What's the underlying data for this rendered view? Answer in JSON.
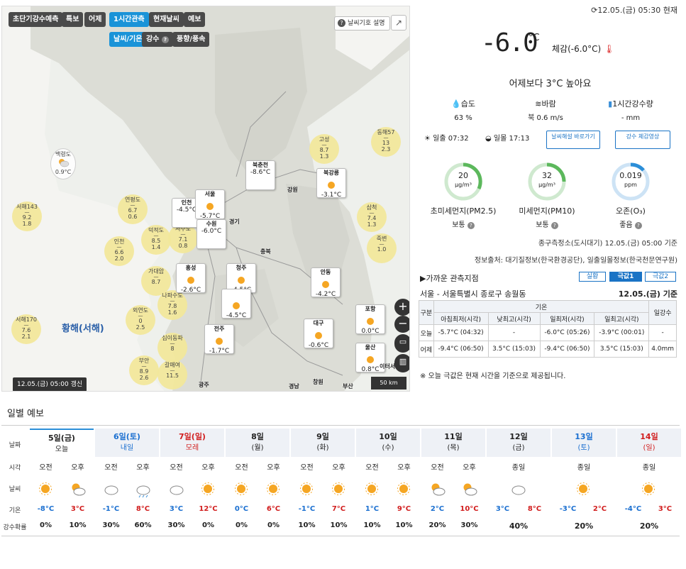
{
  "map": {
    "tabs": [
      "초단기강수예측",
      "특보",
      "어제",
      "1시간관측",
      "현재날씨",
      "예보"
    ],
    "subtabs": [
      "날씨/기온",
      "강수",
      "풍향/풍속"
    ],
    "legend_label": "날씨기호 설명",
    "update_label": "12.05.(금) 05:00 갱신",
    "sea_label": "황해(서해)",
    "scale_label": "50 km",
    "bubbles": [
      {
        "name": "백령도",
        "val": "0.9°C"
      },
      {
        "name": "서해143",
        "val": "9.2",
        "val2": "1.8"
      },
      {
        "name": "연평도",
        "val": "6.7",
        "val2": "0.6"
      },
      {
        "name": "덕적도",
        "val": "8.5",
        "val2": "1.4"
      },
      {
        "name": "서수도",
        "val": "7.1",
        "val2": "0.8"
      },
      {
        "name": "인천",
        "val": "6.6",
        "val2": "2.0"
      },
      {
        "name": "가대암",
        "val": "8.7"
      },
      {
        "name": "나파수도",
        "val": "7.8",
        "val2": "1.6"
      },
      {
        "name": "외연도",
        "val": "0",
        "val2": "2.5"
      },
      {
        "name": "서해170",
        "val": "7.6",
        "val2": "2.1"
      },
      {
        "name": "십이동파",
        "val": "8"
      },
      {
        "name": "부안",
        "val": "8.9",
        "val2": "2.6"
      },
      {
        "name": "갈매여",
        "val": "11.5"
      },
      {
        "name": "고성",
        "val": "8.7",
        "val2": "1.3"
      },
      {
        "name": "동해57",
        "val": "13",
        "val2": "2.3"
      },
      {
        "name": "삼척",
        "val": "7.4",
        "val2": "1.3"
      },
      {
        "name": "죽변",
        "val": "1.0"
      }
    ],
    "cards": [
      {
        "name": "북춘천",
        "val": "-8.6°C"
      },
      {
        "name": "북강릉",
        "val": "-3.1°C"
      },
      {
        "name": "인천",
        "val": "-4.5°C"
      },
      {
        "name": "서울",
        "val": "-5.7°C"
      },
      {
        "name": "수원",
        "val": "-6.0°C"
      },
      {
        "name": "홍성",
        "val": "-2.6°C"
      },
      {
        "name": "청주",
        "val": "-4.5°C"
      },
      {
        "name": "대전",
        "val": "-4.5°C"
      },
      {
        "name": "안동",
        "val": "-4.2°C"
      },
      {
        "name": "포항",
        "val": "0.0°C"
      },
      {
        "name": "대구",
        "val": "-0.6°C"
      },
      {
        "name": "전주",
        "val": "-1.7°C"
      },
      {
        "name": "울산",
        "val": "0.8°C"
      }
    ],
    "places": [
      "강원",
      "경기",
      "충북",
      "이터서",
      "경남",
      "부산",
      "창원",
      "광주"
    ]
  },
  "current": {
    "time": "12.05.(금) 05:30 현재",
    "temp": "-6.0",
    "unit": "°C",
    "feels": "체감(-6.0°C)",
    "compare": "어제보다 3°C 높아요",
    "humidity_label": "습도",
    "humidity": "63 %",
    "wind_label": "바람",
    "wind": "북 0.6 m/s",
    "rain_label": "1시간강수량",
    "rain": "- mm",
    "sunrise_label": "일출",
    "sunrise": "07:32",
    "sunset_label": "일몰",
    "sunset": "17:13",
    "btn1": "날씨해설 바로가기",
    "btn2": "강수 체감영상",
    "pm25_val": "20",
    "pm25_unit": "μg/m³",
    "pm25_name": "초미세먼지(PM2.5)",
    "pm25_status": "보통",
    "pm10_val": "32",
    "pm10_unit": "μg/m³",
    "pm10_name": "미세먼지(PM10)",
    "pm10_status": "보통",
    "o3_val": "0.019",
    "o3_unit": "ppm",
    "o3_name": "오존(O₃)",
    "o3_status": "좋음",
    "note1": "종구측정소(도시대기) 12.05.(금) 05:00 기준",
    "note2": "정보출처: 대기질정보(한국환경공단), 일출일몰정보(한국천문연구원)",
    "near_title": "▶가까운 관측지점",
    "near_tabs": [
      "실황",
      "극값1",
      "극값2"
    ],
    "location": "서울 - 서울특별시 종로구 송월동",
    "loc_date": "12.05.(금) 기준",
    "table_headers": [
      "구분",
      "기온",
      "일강수",
      "아침최저(시각)",
      "낮최고(시각)",
      "일최저(시각)",
      "일최고(시각)"
    ],
    "rows": [
      [
        "오늘",
        "-5.7°C (04:32)",
        "-",
        "-6.0°C (05:26)",
        "-3.9°C (00:01)",
        "-"
      ],
      [
        "어제",
        "-9.4°C (06:50)",
        "3.5°C (15:03)",
        "-9.4°C (06:50)",
        "3.5°C (15:03)",
        "4.0mm"
      ]
    ],
    "footnote": "※ 오늘 극값은 현재 시간을 기준으로 제공됩니다."
  },
  "daily": {
    "title": "일별 예보",
    "row_labels": [
      "날짜",
      "시각",
      "날씨",
      "기온",
      "강수확률"
    ],
    "days": [
      {
        "date": "5일(금)",
        "sub": "오늘",
        "color": "black",
        "split": true,
        "am": "오전",
        "pm": "오후",
        "icon_am": "sun",
        "icon_pm": "sun-cloud",
        "low": "-8°C",
        "high": "3°C",
        "pop_am": "0%",
        "pop_pm": "10%"
      },
      {
        "date": "6일(토)",
        "sub": "내일",
        "color": "blue",
        "split": true,
        "am": "오전",
        "pm": "오후",
        "icon_am": "cloud",
        "icon_pm": "cloud-rain",
        "low": "-1°C",
        "high": "8°C",
        "pop_am": "30%",
        "pop_pm": "60%"
      },
      {
        "date": "7일(일)",
        "sub": "모레",
        "color": "red",
        "split": true,
        "am": "오전",
        "pm": "오후",
        "icon_am": "cloud",
        "icon_pm": "sun",
        "low": "3°C",
        "high": "12°C",
        "pop_am": "30%",
        "pop_pm": "0%"
      },
      {
        "date": "8일",
        "sub": "(월)",
        "color": "black",
        "split": true,
        "am": "오전",
        "pm": "오후",
        "icon_am": "sun",
        "icon_pm": "sun",
        "low": "0°C",
        "high": "6°C",
        "pop_am": "0%",
        "pop_pm": "0%"
      },
      {
        "date": "9일",
        "sub": "(화)",
        "color": "black",
        "split": true,
        "am": "오전",
        "pm": "오후",
        "icon_am": "sun",
        "icon_pm": "sun",
        "low": "-1°C",
        "high": "7°C",
        "pop_am": "10%",
        "pop_pm": "10%"
      },
      {
        "date": "10일",
        "sub": "(수)",
        "color": "black",
        "split": true,
        "am": "오전",
        "pm": "오후",
        "icon_am": "sun",
        "icon_pm": "sun",
        "low": "1°C",
        "high": "9°C",
        "pop_am": "10%",
        "pop_pm": "10%"
      },
      {
        "date": "11일",
        "sub": "(목)",
        "color": "black",
        "split": true,
        "am": "오전",
        "pm": "오후",
        "icon_am": "sun-cloud",
        "icon_pm": "sun-cloud",
        "low": "2°C",
        "high": "10°C",
        "pop_am": "20%",
        "pop_pm": "30%"
      },
      {
        "date": "12일",
        "sub": "(금)",
        "color": "black",
        "split": false,
        "all": "종일",
        "icon": "cloud",
        "low": "3°C",
        "high": "8°C",
        "pop": "40%"
      },
      {
        "date": "13일",
        "sub": "(토)",
        "color": "blue",
        "split": false,
        "all": "종일",
        "icon": "sun",
        "low": "-3°C",
        "high": "2°C",
        "pop": "20%"
      },
      {
        "date": "14일",
        "sub": "(일)",
        "color": "red",
        "split": false,
        "all": "종일",
        "icon": "sun",
        "low": "-4°C",
        "high": "3°C",
        "pop": "20%"
      }
    ]
  }
}
